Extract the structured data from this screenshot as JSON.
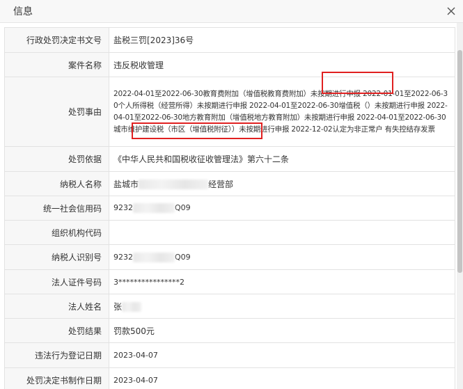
{
  "dialog": {
    "title": "信息"
  },
  "rows": [
    {
      "label": "行政处罚决定书文号",
      "value": "盐税三罚[2023]36号"
    },
    {
      "label": "案件名称",
      "value": "违反税收管理"
    },
    {
      "label": "处罚事由",
      "value": "2022-04-01至2022-06-30教育费附加（增值税教育费附加）未按期进行申报 2022-01-01至2022-06-30个人所得税（经营所得）未按期进行申报 2022-04-01至2022-06-30增值税（）未按期进行申报 2022-04-01至2022-06-30地方教育附加（增值税地方教育附加）未按期进行申报 2022-04-01至2022-06-30城市维护建设税（市区（增值税附征））未按期进行申报 2022-12-02认定为非正常户 有失控结存发票"
    },
    {
      "label": "处罚依据",
      "value": "《中华人民共和国税收征收管理法》第六十二条"
    },
    {
      "label": "纳税人名称",
      "value_prefix": "盐城市",
      "value_suffix": "经营部"
    },
    {
      "label": "统一社会信用码",
      "value_prefix": "9232",
      "value_suffix": "Q09"
    },
    {
      "label": "组织机构代码",
      "value": ""
    },
    {
      "label": "纳税人识别号",
      "value_prefix": "9232",
      "value_suffix": "Q09"
    },
    {
      "label": "法人证件号码",
      "value": "3****************2"
    },
    {
      "label": "法人姓名",
      "value_prefix": "张",
      "value_suffix": ""
    },
    {
      "label": "处罚结果",
      "value": "罚款500元"
    },
    {
      "label": "违法行为登记日期",
      "value": "2023-04-07"
    },
    {
      "label": "处罚决定书制作日期",
      "value": "2023-04-07"
    }
  ],
  "colors": {
    "highlight": "#e02020",
    "label_bg": "#f7f7f7",
    "border": "#e2e2e2"
  }
}
